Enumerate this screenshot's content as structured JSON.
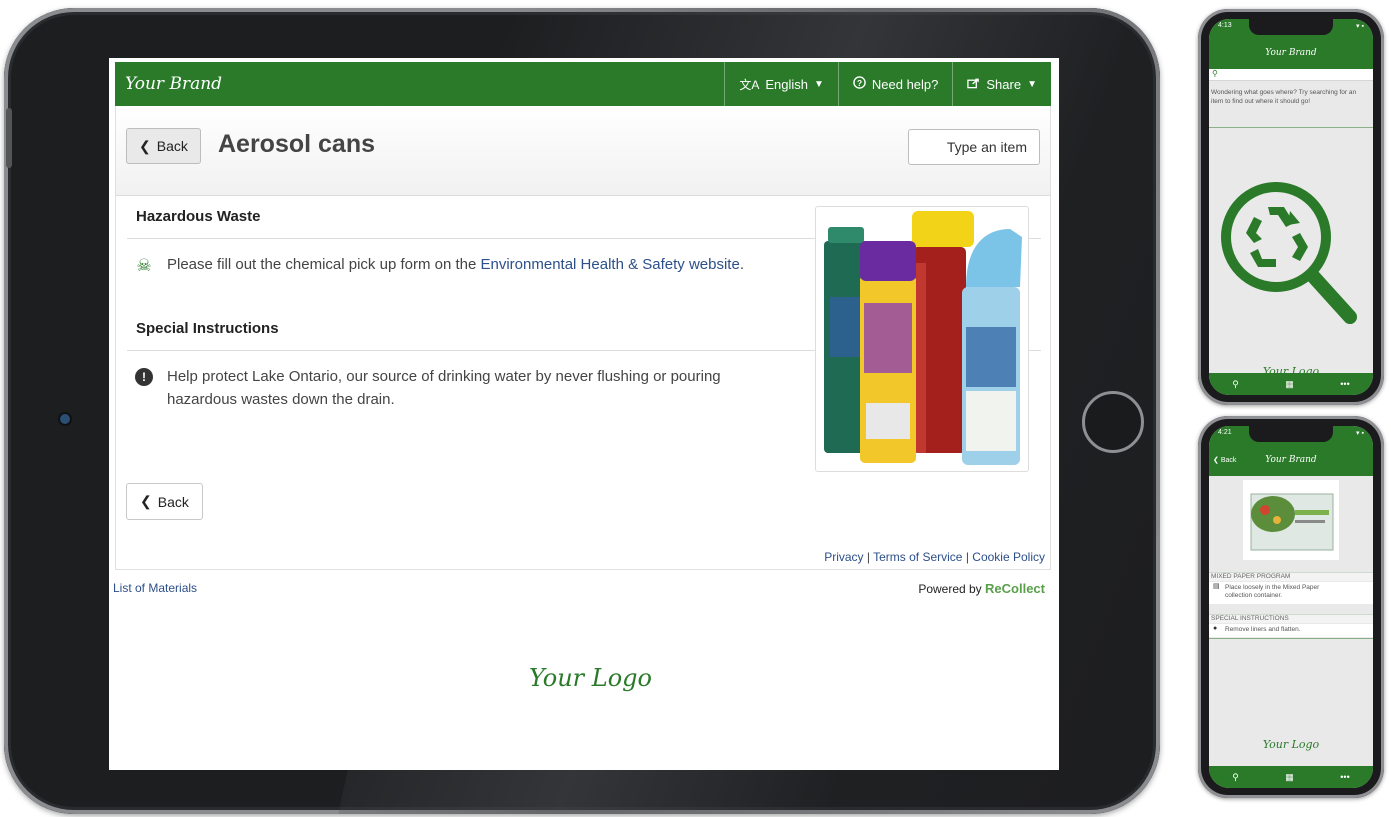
{
  "web": {
    "brand": "Your Brand",
    "nav": {
      "language_icon": "translate-icon",
      "language_label": "English",
      "help_icon": "help-circle-icon",
      "help_label": "Need help?",
      "share_icon": "share-icon",
      "share_label": "Share"
    },
    "back_label": "Back",
    "page_title": "Aerosol cans",
    "search_placeholder": "Type an item",
    "sections": [
      {
        "heading": "Hazardous Waste",
        "icon": "skull-crossbones-icon",
        "text_before": "Please fill out the chemical pick up form on the ",
        "link_text": "Environmental Health & Safety website",
        "text_after": "."
      },
      {
        "heading": "Special Instructions",
        "icon": "exclamation-circle-icon",
        "text_line1": "Help protect Lake Ontario, our source of drinking water by never flushing or pouring",
        "text_line2": "hazardous wastes down the drain."
      }
    ],
    "bottom_back_label": "Back",
    "footer": {
      "privacy": "Privacy",
      "terms": "Terms of Service",
      "cookie": "Cookie Policy",
      "sep": "|",
      "materials": "List of Materials",
      "powered_by": "Powered by",
      "powered_brand": "ReCollect"
    },
    "logo_text": "Your Logo"
  },
  "phone_home": {
    "time": "4:13",
    "brand": "Your Brand",
    "hint": "Wondering what goes where? Try searching for an item to find out where it should go!",
    "logo_text": "Your Logo",
    "tabs": [
      "search-icon",
      "calendar-icon",
      "more-icon"
    ]
  },
  "phone_detail": {
    "time": "4:21",
    "back_label": "Back",
    "brand": "Your Brand",
    "section1": "MIXED PAPER PROGRAM",
    "line1a": "Place loosely in the Mixed Paper",
    "line1b": "collection container.",
    "section2": "SPECIAL INSTRUCTIONS",
    "line2": "Remove liners and flatten.",
    "logo_text": "Your Logo"
  },
  "colors": {
    "brand_green": "#2a7a2a",
    "link_blue": "#2d4f8a",
    "recollect_green": "#5aa04a"
  }
}
